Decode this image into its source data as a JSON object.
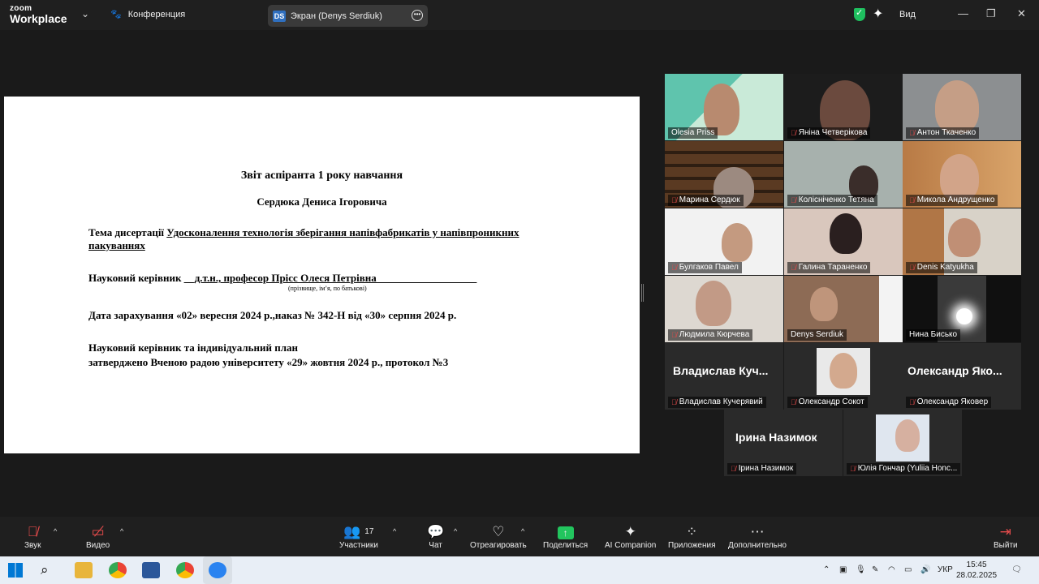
{
  "topbar": {
    "logo_line1": "zoom",
    "logo_line2": "Workplace",
    "meeting_label": "Конференция",
    "screen_badge": "DS",
    "screen_label": "Экран (Denys Serdiuk)",
    "view_label": "Вид"
  },
  "document": {
    "title": "Звіт аспіранта 1 року навчання",
    "student": "Сердюка Дениса Ігоровича",
    "topic_prefix": "Тема дисертації ",
    "topic_value": "Удосконалення технологія зберігання напівфабрикатів у напівпроникних пакуваннях",
    "supervisor_prefix": "Науковий керівник ",
    "supervisor_value": "__д.т.н., професор Прісс Олеся Петрівна___________________",
    "supervisor_hint": "(прізвище, ім’я, по батькові)",
    "enrollment": "Дата зарахування «02» вересня 2024 р.,наказ № 342-Н від «30» серпня 2024 р.",
    "plan_line1": "Науковий керівник та індивідуальний план",
    "plan_line2": "затверджено Вченою радою університету «29» жовтня 2024 р., протокол №3"
  },
  "participants": [
    {
      "name": "Olesia Priss",
      "muted": false
    },
    {
      "name": "Яніна Четверікова",
      "muted": true
    },
    {
      "name": "Антон Ткаченко",
      "muted": true
    },
    {
      "name": "Марина Сердюк",
      "muted": true
    },
    {
      "name": "Колісніченко Тетяна",
      "muted": true
    },
    {
      "name": "Микола Андрущенко",
      "muted": true
    },
    {
      "name": "Булгаков Павел",
      "muted": true
    },
    {
      "name": "Галина Тараненко",
      "muted": true
    },
    {
      "name": "Denis Katyukha",
      "muted": true
    },
    {
      "name": "Людмила Кюрчева",
      "muted": true
    },
    {
      "name": "Denys Serdiuk",
      "muted": false
    },
    {
      "name": "Нина Бисько",
      "muted": false
    },
    {
      "name": "Владислав Кучерявий",
      "muted": true,
      "display": "Владислав Куч..."
    },
    {
      "name": "Олександр Сокот",
      "muted": true
    },
    {
      "name": "Олександр Яковер",
      "muted": true,
      "display": "Олександр Яко..."
    },
    {
      "name": "Ірина Назимок",
      "muted": true,
      "display": "Ірина Назимок"
    },
    {
      "name": "Юлія Гончар (Yuliia Honc...",
      "muted": true
    }
  ],
  "toolbar": {
    "audio": "Звук",
    "video": "Видео",
    "participants": "Участники",
    "participants_count": "17",
    "chat": "Чат",
    "react": "Отреагировать",
    "share": "Поделиться",
    "ai": "AI Companion",
    "apps": "Приложения",
    "more": "Дополнительно",
    "leave": "Выйти"
  },
  "taskbar": {
    "lang": "УКР",
    "time": "15:45",
    "date": "28.02.2025"
  }
}
